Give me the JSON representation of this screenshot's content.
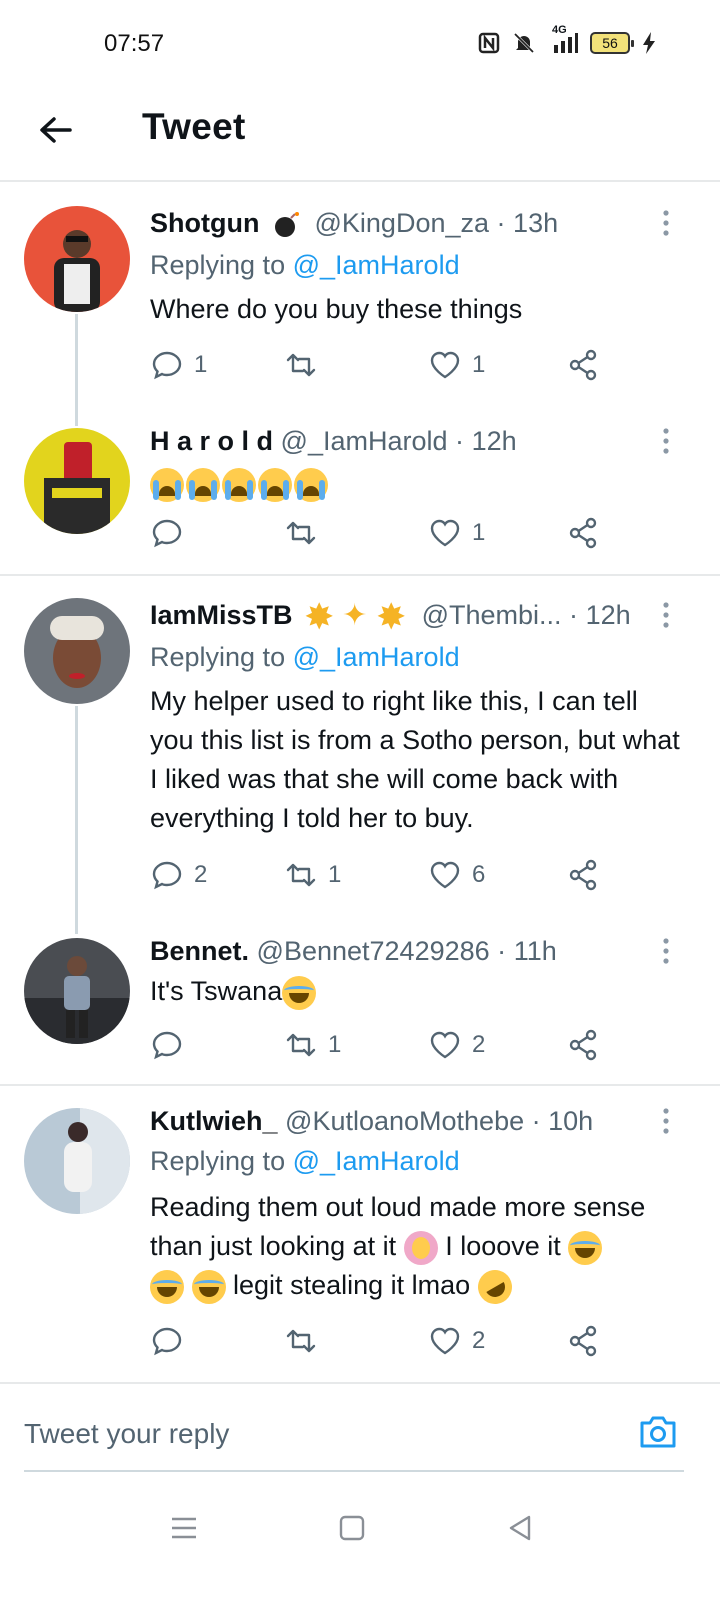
{
  "status_bar": {
    "time": "07:57",
    "network": "4G",
    "battery": "56"
  },
  "header": {
    "title": "Tweet"
  },
  "tweets": [
    {
      "name": "Shotgun",
      "name_emoji": "bomb",
      "handle": "@KingDon_za",
      "time": "13h",
      "replying_label": "Replying to",
      "replying_to": "@_IamHarold",
      "text": "Where do you buy these things",
      "replies": "1",
      "retweets": "",
      "likes": "1",
      "avatar_color": "#e8533a"
    },
    {
      "name": "H a r o l d",
      "handle": "@_IamHarold",
      "time": "12h",
      "text_emoji": [
        "loudly-crying-face",
        "loudly-crying-face",
        "loudly-crying-face",
        "loudly-crying-face",
        "loudly-crying-face"
      ],
      "replies": "",
      "retweets": "",
      "likes": "1",
      "avatar_color": "#e2d41d"
    },
    {
      "name": "IamMissTB",
      "name_emoji": [
        "star",
        "dizzy",
        "star"
      ],
      "handle": "@Thembi...",
      "time": "12h",
      "replying_label": "Replying to",
      "replying_to": "@_IamHarold",
      "text": "My helper used to right like this, I can tell you this list is from a Sotho person, but what I liked was that she will come back with everything I told her to buy.",
      "replies": "2",
      "retweets": "1",
      "likes": "6",
      "avatar_color": "#8a8f96"
    },
    {
      "name": "Bennet.",
      "handle": "@Bennet72429286",
      "time": "11h",
      "text": "It's Tswana",
      "text_trailing_emoji": "face-with-tears-of-joy",
      "replies": "",
      "retweets": "1",
      "likes": "2",
      "avatar_color": "#5a5e63"
    },
    {
      "name": "Kutlwieh_",
      "handle": "@KutloanoMothebe",
      "time": "10h",
      "replying_label": "Replying to",
      "replying_to": "@_IamHarold",
      "text_line1": "Reading them out loud made more sense",
      "text_line2a": "than just looking at it",
      "text_line2b": "I looove it",
      "text_line3": "legit stealing it lmao",
      "replies": "",
      "retweets": "",
      "likes": "2",
      "avatar_color": "#9fb6c9"
    }
  ],
  "separator": "·",
  "compose": {
    "placeholder": "Tweet your reply"
  },
  "colors": {
    "accent": "#1d9bf0",
    "text": "#0f1419",
    "muted": "#536471",
    "divider": "#e7e9ea"
  }
}
